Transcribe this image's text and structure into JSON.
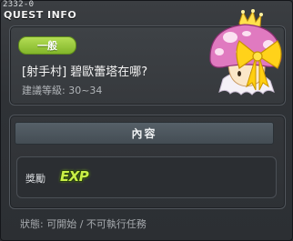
{
  "window": {
    "quest_id": "2332-0",
    "title": "QUEST INFO"
  },
  "quest": {
    "category": "一般",
    "name": "[射手村] 碧歐蕾塔在哪?",
    "level": "建議等級: 30~34"
  },
  "content": {
    "header": "內容",
    "reward_label": "獎勵",
    "reward_value": "EXP"
  },
  "footer": {
    "status": "狀態: 可開始 / 不可執行任務"
  },
  "colors": {
    "badge_green": "#9ccc3f",
    "exp_green": "#c9f046",
    "mushroom_pink": "#e07ac0",
    "ribbon_yellow": "#ffd21a"
  },
  "icons": {
    "npc": "pink-mushroom-with-crown-and-bow"
  }
}
